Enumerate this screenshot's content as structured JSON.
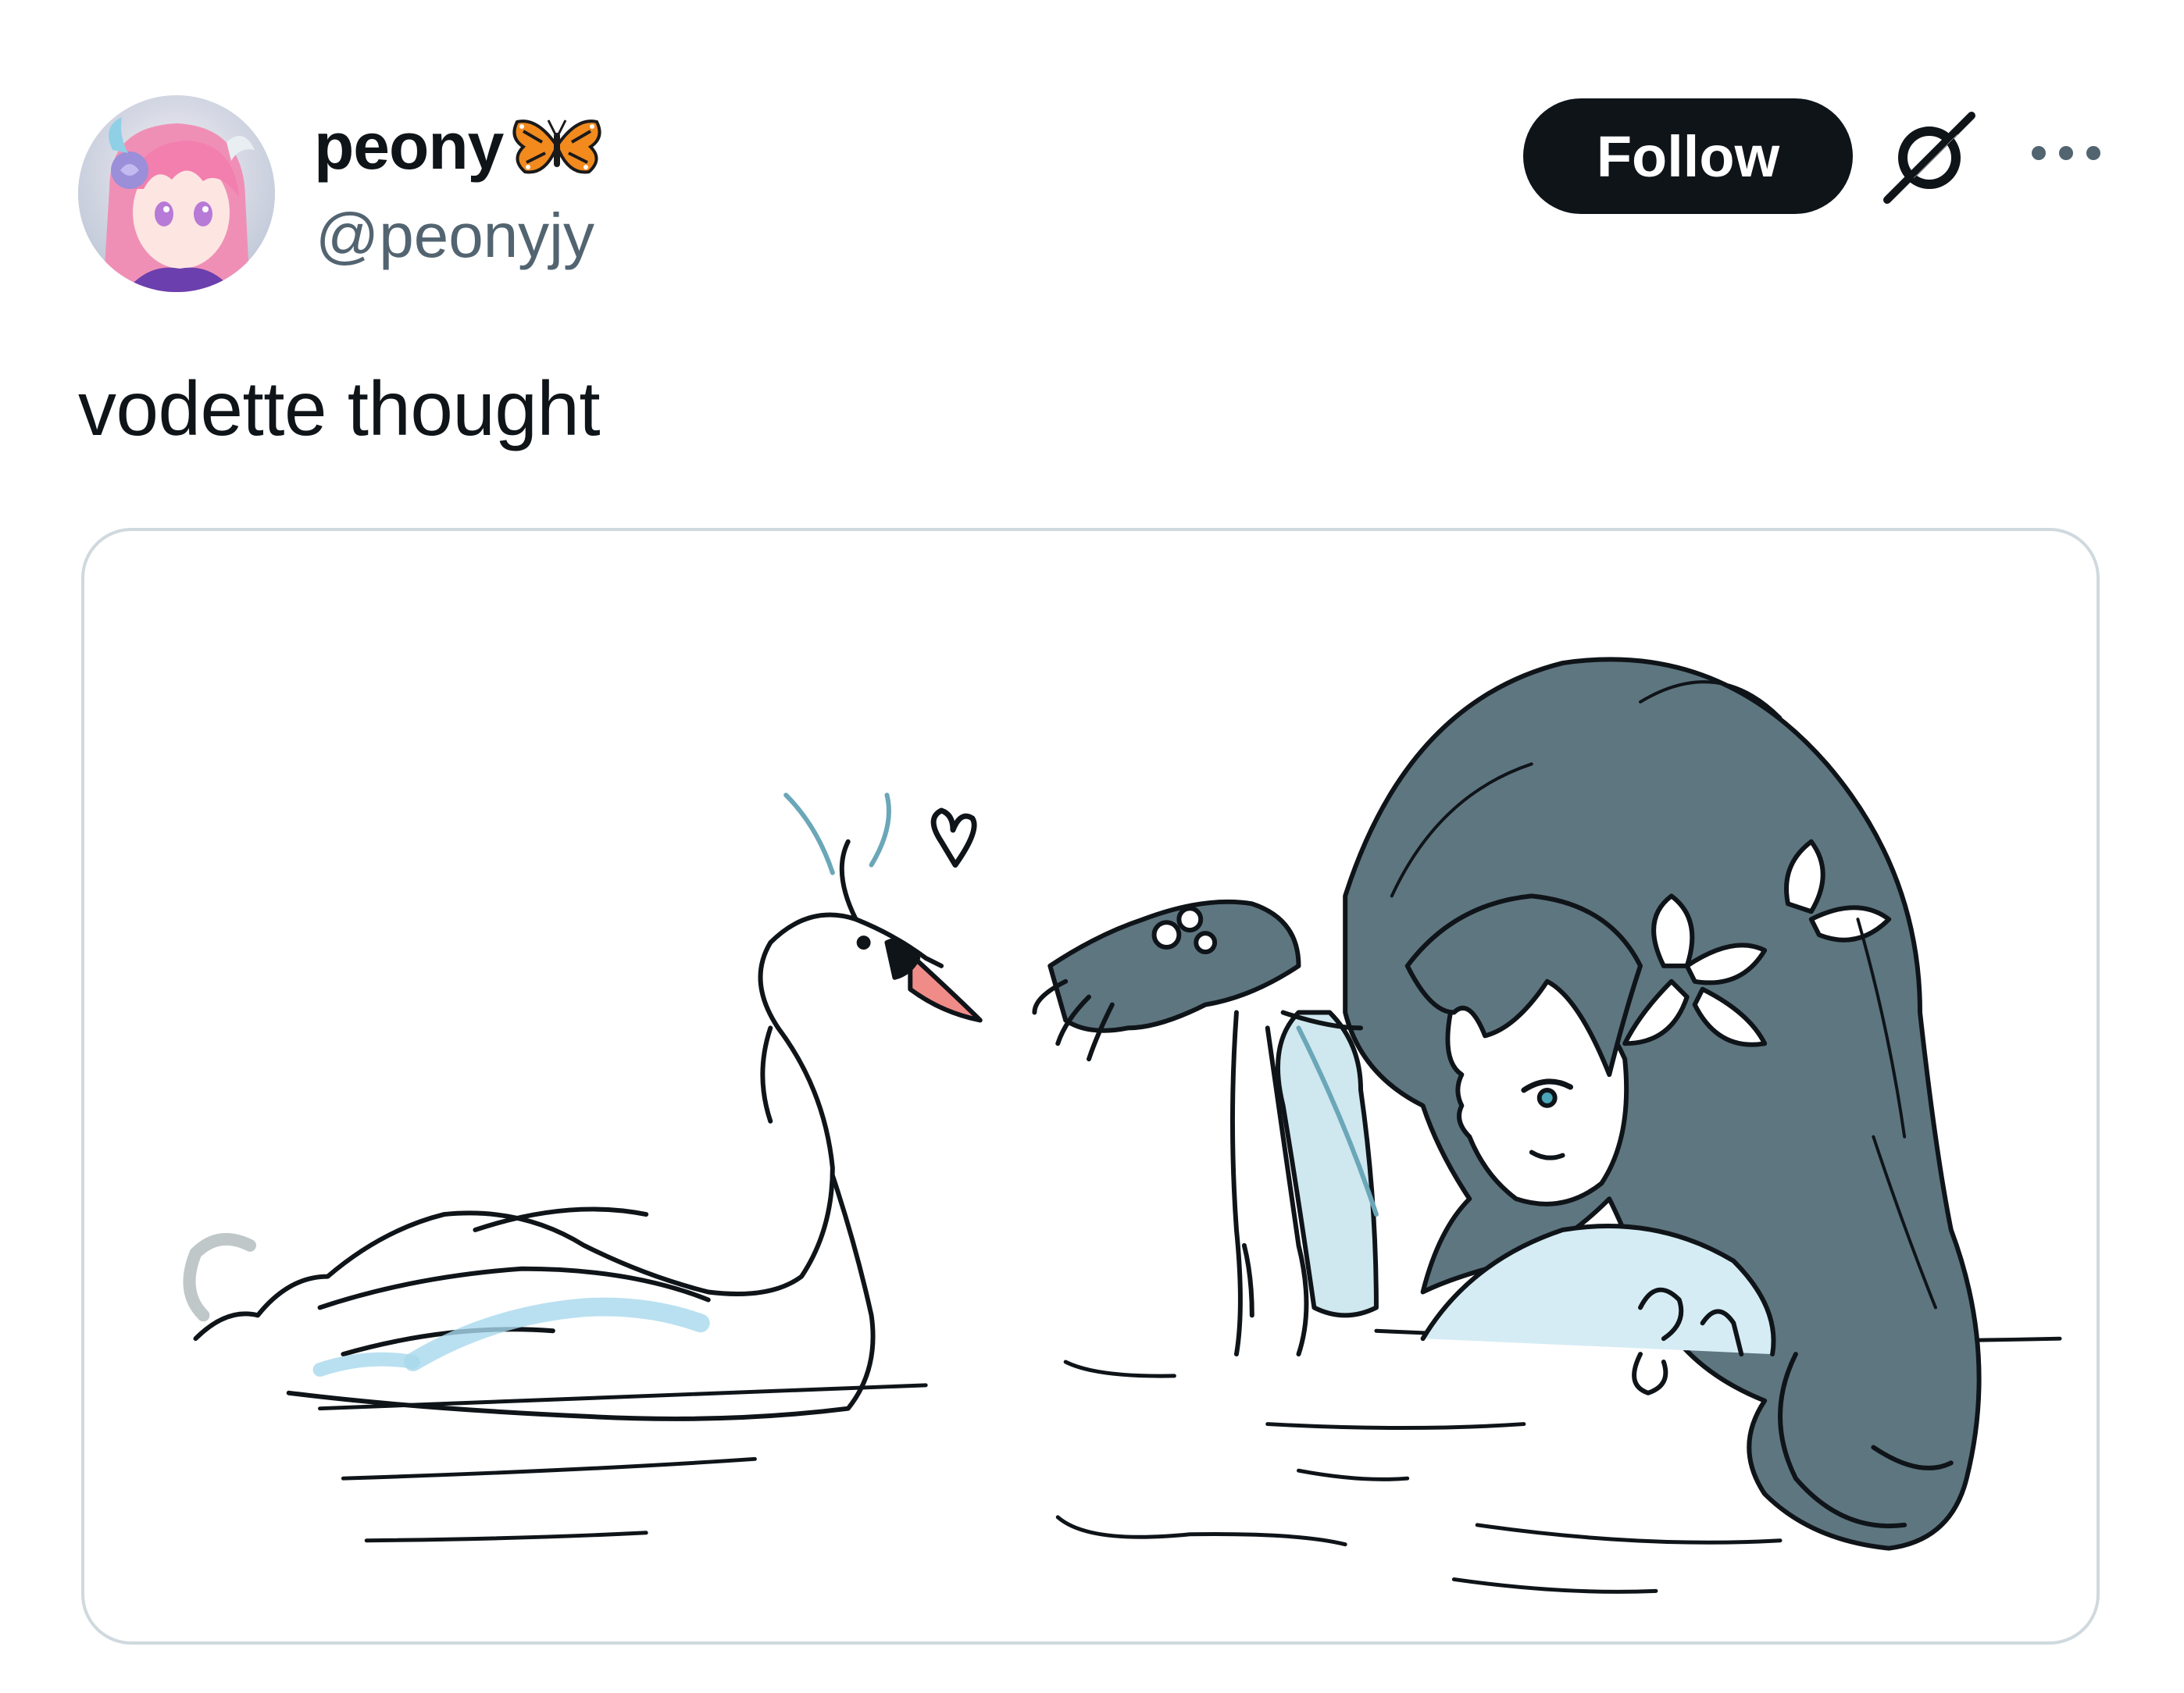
{
  "author": {
    "display_name": "peony",
    "handle": "@peonyjy",
    "avatar_icon": "anime-avatar-pink-hair",
    "badge_icon": "butterfly-icon"
  },
  "actions": {
    "follow_label": "Follow",
    "grok_icon": "grok-icon",
    "more_icon": "more-icon"
  },
  "tweet": {
    "text": "vodette thought"
  },
  "media": {
    "kind": "illustration",
    "icon": "swan-and-girl-sketch"
  },
  "colors": {
    "follow_bg": "#0f1419",
    "follow_text": "#ffffff",
    "handle": "#536471",
    "card_border": "#cfd9de",
    "hair": "#5e7680",
    "water_accent": "#a8d8ec",
    "beak": "#f08c88"
  }
}
